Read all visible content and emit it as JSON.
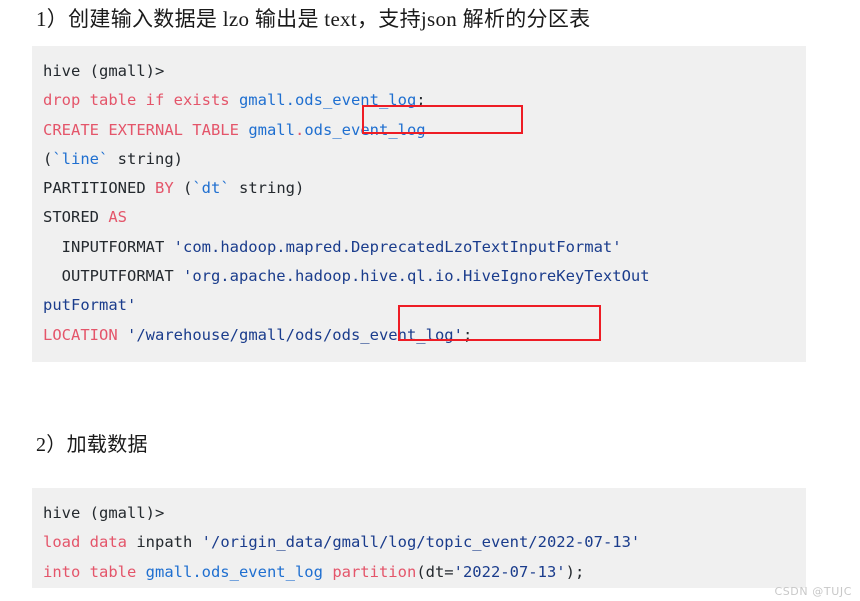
{
  "document": {
    "watermark": "CSDN @TUJC"
  },
  "sections": [
    {
      "heading": "1）创建输入数据是 lzo 输出是 text，支持json 解析的分区表"
    },
    {
      "heading": "2）加载数据"
    }
  ],
  "code_block_1": {
    "lines": [
      {
        "tokens": [
          {
            "text": "hive (gmall)>",
            "style": "pl"
          }
        ]
      },
      {
        "tokens": [
          {
            "text": "drop table if exists ",
            "style": "kw"
          },
          {
            "text": "gmall.ods_event_log",
            "style": "id"
          },
          {
            "text": ";",
            "style": "pl"
          }
        ]
      },
      {
        "tokens": [
          {
            "text": "CREATE EXTERNAL TABLE ",
            "style": "kw"
          },
          {
            "text": "gmall",
            "style": "id"
          },
          {
            "text": ".",
            "style": "kw"
          },
          {
            "text": "ods_event_log",
            "style": "id"
          }
        ]
      },
      {
        "tokens": [
          {
            "text": "(",
            "style": "pl"
          },
          {
            "text": "`line`",
            "style": "id"
          },
          {
            "text": " string)",
            "style": "pl"
          }
        ]
      },
      {
        "tokens": [
          {
            "text": "PARTITIONED ",
            "style": "pl"
          },
          {
            "text": "BY",
            "style": "kw"
          },
          {
            "text": " (",
            "style": "pl"
          },
          {
            "text": "`dt`",
            "style": "id"
          },
          {
            "text": " string)",
            "style": "pl"
          }
        ]
      },
      {
        "tokens": [
          {
            "text": "STORED ",
            "style": "pl"
          },
          {
            "text": "AS",
            "style": "kw"
          }
        ]
      },
      {
        "tokens": [
          {
            "text": "  INPUTFORMAT ",
            "style": "pl"
          },
          {
            "text": "'com.hadoop.mapred.DeprecatedLzoTextInputFormat'",
            "style": "str"
          }
        ]
      },
      {
        "tokens": [
          {
            "text": "  OUTPUTFORMAT ",
            "style": "pl"
          },
          {
            "text": "'org.apache.hadoop.hive.ql.io.HiveIgnoreKeyTextOut",
            "style": "str"
          }
        ]
      },
      {
        "tokens": [
          {
            "text": "putFormat'",
            "style": "str"
          }
        ]
      },
      {
        "tokens": [
          {
            "text": "LOCATION",
            "style": "kw"
          },
          {
            "text": " ",
            "style": "pl"
          },
          {
            "text": "'/warehouse/gmall/ods/ods_event_log'",
            "style": "str"
          },
          {
            "text": ";",
            "style": "pl"
          }
        ]
      }
    ]
  },
  "code_block_2": {
    "lines": [
      {
        "tokens": [
          {
            "text": "hive (gmall)>",
            "style": "pl"
          }
        ]
      },
      {
        "tokens": [
          {
            "text": "load data ",
            "style": "kw"
          },
          {
            "text": "inpath",
            "style": "pl"
          },
          {
            "text": " ",
            "style": "pl"
          },
          {
            "text": "'/origin_data/gmall/log/topic_event/2022-07-13'",
            "style": "str"
          }
        ]
      },
      {
        "tokens": [
          {
            "text": "into table ",
            "style": "kw"
          },
          {
            "text": "gmall.ods_event_log",
            "style": "id"
          },
          {
            "text": " ",
            "style": "pl"
          },
          {
            "text": "partition",
            "style": "kw"
          },
          {
            "text": "(dt=",
            "style": "pl"
          },
          {
            "text": "'2022-07-13'",
            "style": "str"
          },
          {
            "text": ");",
            "style": "pl"
          }
        ]
      }
    ]
  },
  "annotations": {
    "box_color": "#ee1c25",
    "boxes": [
      {
        "label": "ods_event_log",
        "target": "create-table-name"
      },
      {
        "label": "ods_event_log';",
        "target": "location-path-tail"
      }
    ]
  },
  "colors": {
    "code_background": "#f0f0f0",
    "keyword": "#e4556a",
    "identifier": "#1f6fd0",
    "string": "#1a3c8c",
    "plain": "#24292e",
    "page_background": "#ffffff"
  }
}
